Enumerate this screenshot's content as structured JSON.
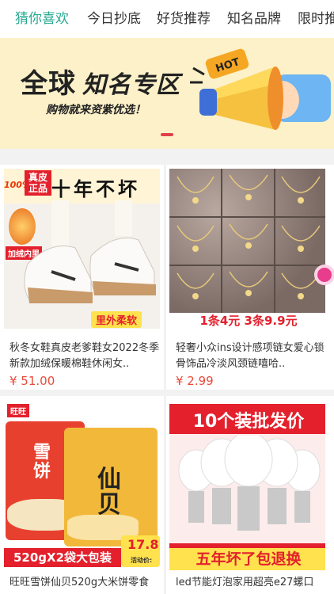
{
  "tabs": [
    {
      "label": "猜你喜欢"
    },
    {
      "label": "今日抄底"
    },
    {
      "label": "好货推荐"
    },
    {
      "label": "知名品牌"
    },
    {
      "label": "限时推"
    }
  ],
  "banner": {
    "title_plain": "全球",
    "title_bold": "知名专区",
    "subtitle": "购物就来资紫优选！",
    "badge": "HOT"
  },
  "products": [
    {
      "name": "秋冬女鞋真皮老爹鞋女2022冬季新款加绒保暖棉鞋休闲女..",
      "price": "¥ 51.00",
      "image_text": {
        "top": "十年不坏",
        "corner": "100%",
        "badge": "真皮正品",
        "side": "加绒内里",
        "bottom": "里外柔软"
      }
    },
    {
      "name": "轻奢小众ins设计感项链女爱心锁骨饰品冷淡风颈链嘻哈..",
      "price": "¥ 2.99",
      "image_text": {
        "bottom": "1条4元 3条9.9元"
      }
    },
    {
      "name": "旺旺雪饼仙贝520g大米饼零食",
      "price": "",
      "image_text": {
        "top": "旺旺",
        "pack1": "雪饼",
        "pack2": "仙贝",
        "bottom": "520gX2袋大包装",
        "price_tag": "17.8",
        "price_sub": "活动价:"
      }
    },
    {
      "name": "led节能灯泡家用超亮e27螺口",
      "price": "",
      "image_text": {
        "top": "10个装批发价",
        "bottom": "五年坏了包退换"
      }
    }
  ],
  "colors": {
    "accent": "#25a88f",
    "price": "#e84b3c",
    "banner_bg": "#fdf1c9"
  }
}
